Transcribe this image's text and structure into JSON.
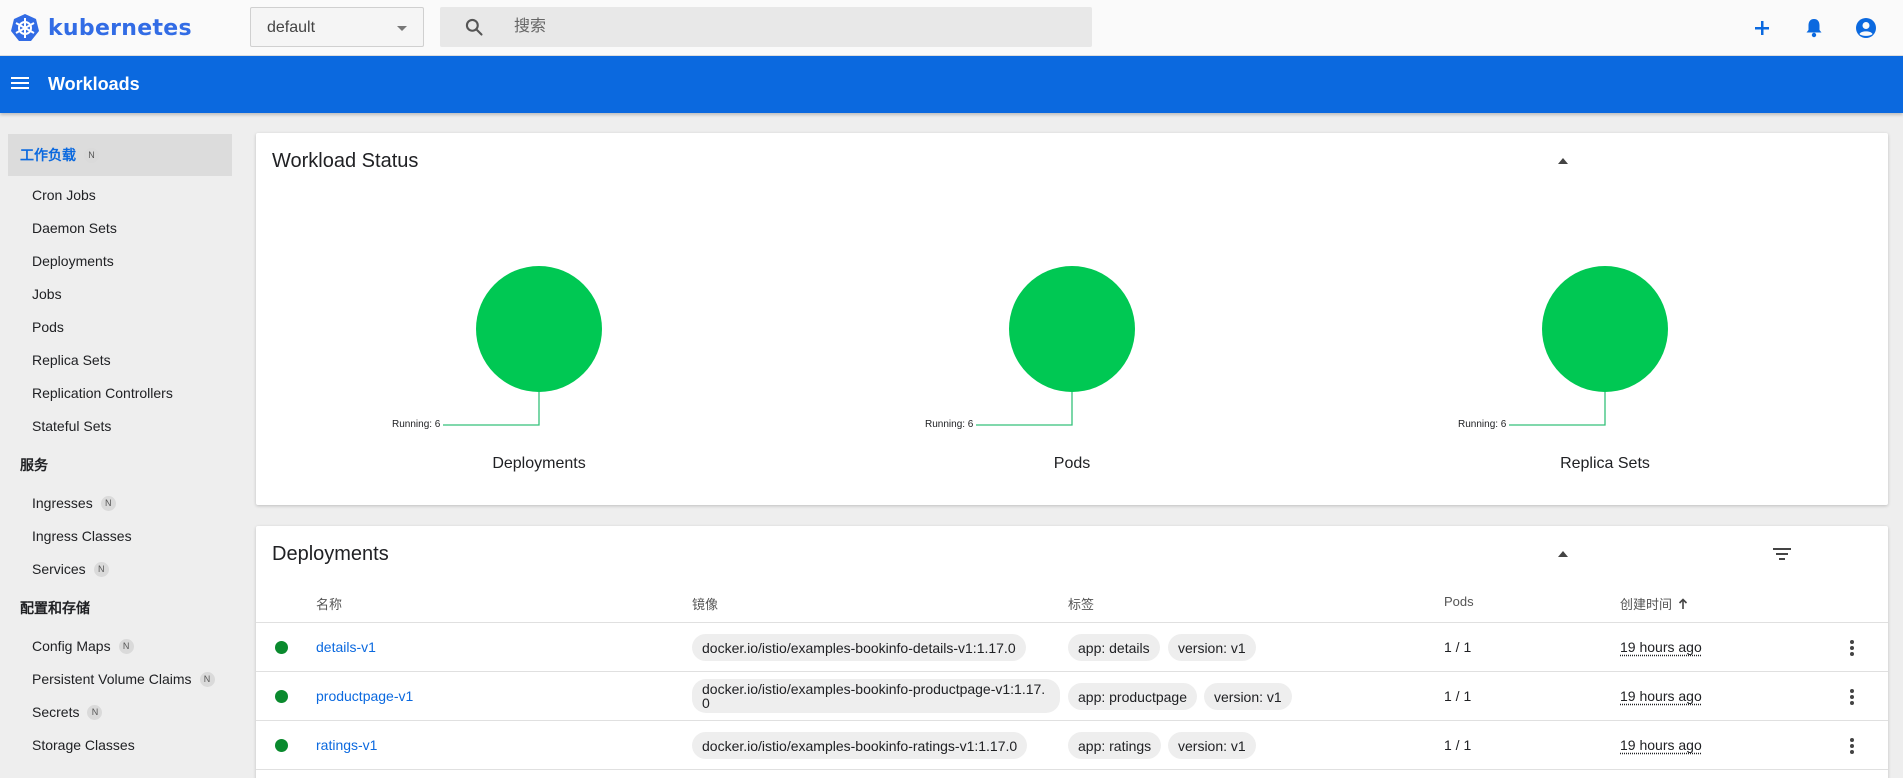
{
  "topbar": {
    "logo_text": "kubernetes",
    "namespace": "default",
    "search_placeholder": "搜索"
  },
  "appbar": {
    "title": "Workloads"
  },
  "sidebar": {
    "sections": [
      {
        "label": "工作负载",
        "badge": "N",
        "items": [
          {
            "label": "Cron Jobs"
          },
          {
            "label": "Daemon Sets"
          },
          {
            "label": "Deployments"
          },
          {
            "label": "Jobs"
          },
          {
            "label": "Pods"
          },
          {
            "label": "Replica Sets"
          },
          {
            "label": "Replication Controllers"
          },
          {
            "label": "Stateful Sets"
          }
        ]
      },
      {
        "label": "服务",
        "items": [
          {
            "label": "Ingresses",
            "badge": "N"
          },
          {
            "label": "Ingress Classes"
          },
          {
            "label": "Services",
            "badge": "N"
          }
        ]
      },
      {
        "label": "配置和存储",
        "items": [
          {
            "label": "Config Maps",
            "badge": "N"
          },
          {
            "label": "Persistent Volume Claims",
            "badge": "N"
          },
          {
            "label": "Secrets",
            "badge": "N"
          },
          {
            "label": "Storage Classes"
          }
        ]
      }
    ]
  },
  "workload_status": {
    "title": "Workload Status",
    "charts": [
      {
        "name": "Deployments",
        "running_label": "Running: 6",
        "running": 6,
        "color": "#00c853"
      },
      {
        "name": "Pods",
        "running_label": "Running: 6",
        "running": 6,
        "color": "#00c853"
      },
      {
        "name": "Replica Sets",
        "running_label": "Running: 6",
        "running": 6,
        "color": "#00c853"
      }
    ]
  },
  "deployments": {
    "title": "Deployments",
    "columns": [
      "名称",
      "镜像",
      "标签",
      "Pods",
      "创建时间"
    ],
    "rows": [
      {
        "name": "details-v1",
        "image": "docker.io/istio/examples-bookinfo-details-v1:1.17.0",
        "labels": [
          "app: details",
          "version: v1"
        ],
        "pods": "1 / 1",
        "created": "19 hours ago"
      },
      {
        "name": "productpage-v1",
        "image": "docker.io/istio/examples-bookinfo-productpage-v1:1.17.0",
        "labels": [
          "app: productpage",
          "version: v1"
        ],
        "pods": "1 / 1",
        "created": "19 hours ago"
      },
      {
        "name": "ratings-v1",
        "image": "docker.io/istio/examples-bookinfo-ratings-v1:1.17.0",
        "labels": [
          "app: ratings",
          "version: v1"
        ],
        "pods": "1 / 1",
        "created": "19 hours ago"
      }
    ]
  },
  "colors": {
    "brand": "#326ce5",
    "appbar": "#0b69df",
    "running": "#00c853",
    "status_ok": "#0a8a2e"
  },
  "icons": [
    "kubernetes-logo-icon",
    "search-icon",
    "plus-icon",
    "bell-icon",
    "account-icon",
    "menu-icon",
    "filter-icon",
    "chevron-up-icon",
    "more-vert-icon",
    "sort-arrow-up-icon"
  ]
}
